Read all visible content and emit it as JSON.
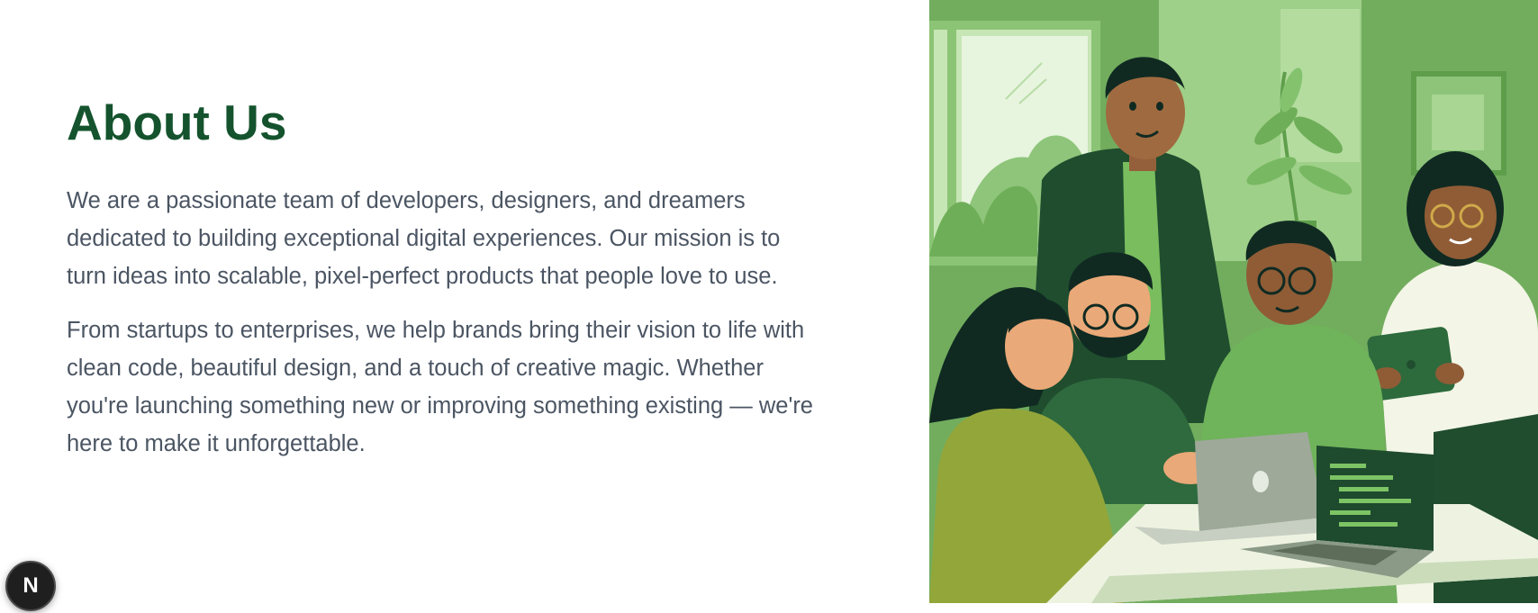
{
  "about": {
    "title": "About Us",
    "paragraph_1": "We are a passionate team of developers, designers, and dreamers dedicated to building exceptional digital experiences. Our mission is to turn ideas into scalable, pixel-perfect products that people love to use.",
    "paragraph_2": "From startups to enterprises, we help brands bring their vision to life with clean code, beautiful design, and a touch of creative magic. Whether you're launching something new or improving something existing — we're here to make it unforgettable."
  },
  "illustration": {
    "icon": "team-illustration"
  },
  "dev_badge": {
    "label": "N",
    "icon": "nextjs-logo-icon"
  },
  "colors": {
    "heading": "#14532d",
    "body_text": "#4b5563",
    "illustration_bg": "#6fad5a"
  }
}
